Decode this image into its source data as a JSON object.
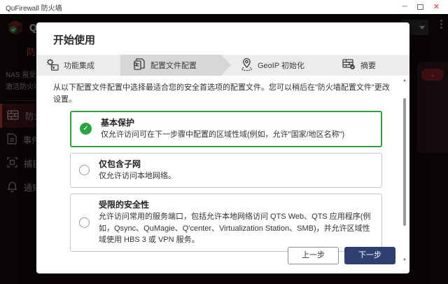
{
  "window": {
    "title": "QuFirewall 防火墙",
    "controls": {
      "minimize": "─",
      "close": "✕"
    }
  },
  "header": {
    "brand": "QuFirewall"
  },
  "sidebar": {
    "heading": "防火墙",
    "notice_line1": "NAS 易受攻击。",
    "notice_line2": "激活防火墙。",
    "items": [
      {
        "label": "防火墙",
        "icon": "firewall-icon"
      },
      {
        "label": "事件",
        "icon": "events-icon"
      },
      {
        "label": "捕获",
        "icon": "capture-icon"
      },
      {
        "label": "通知",
        "icon": "bell-icon"
      }
    ]
  },
  "wizard": {
    "title": "开始使用",
    "steps": [
      {
        "label": "功能集成",
        "icon": "integration-icon",
        "active": false
      },
      {
        "label": "配置文件配置",
        "icon": "profile-config-icon",
        "active": true
      },
      {
        "label": "GeoIP 初始化",
        "icon": "geoip-icon",
        "active": false
      },
      {
        "label": "摘要",
        "icon": "summary-icon",
        "active": false
      }
    ],
    "intro": "从以下配置文件配置中选择最适合您的安全首选项的配置文件。您可以稍后在\"防火墙配置文件\"更改设置。",
    "options": [
      {
        "title": "基本保护",
        "desc": "仅允许访问可在下一步骤中配置的区域性域(例如，允许\"国家/地区名称\")",
        "selected": true
      },
      {
        "title": "仅包含子网",
        "desc": "仅允许访问本地网络。",
        "selected": false
      },
      {
        "title": "受限的安全性",
        "desc": "允许访问常用的服务端口，包括允许本地网络访问 QTS Web、QTS 应用程序(例如，Qsync、QuMagie、Q'center、Virtualization Station、SMB)，并允许区域性域使用 HBS 3 或 VPN 服务。",
        "selected": false
      }
    ],
    "footer": {
      "back": "上一步",
      "next": "下一步"
    }
  },
  "colors": {
    "accent_green": "#28a53c",
    "primary_navy": "#2e4070",
    "brand_red": "#b03a31",
    "close_red": "#d23b30"
  }
}
